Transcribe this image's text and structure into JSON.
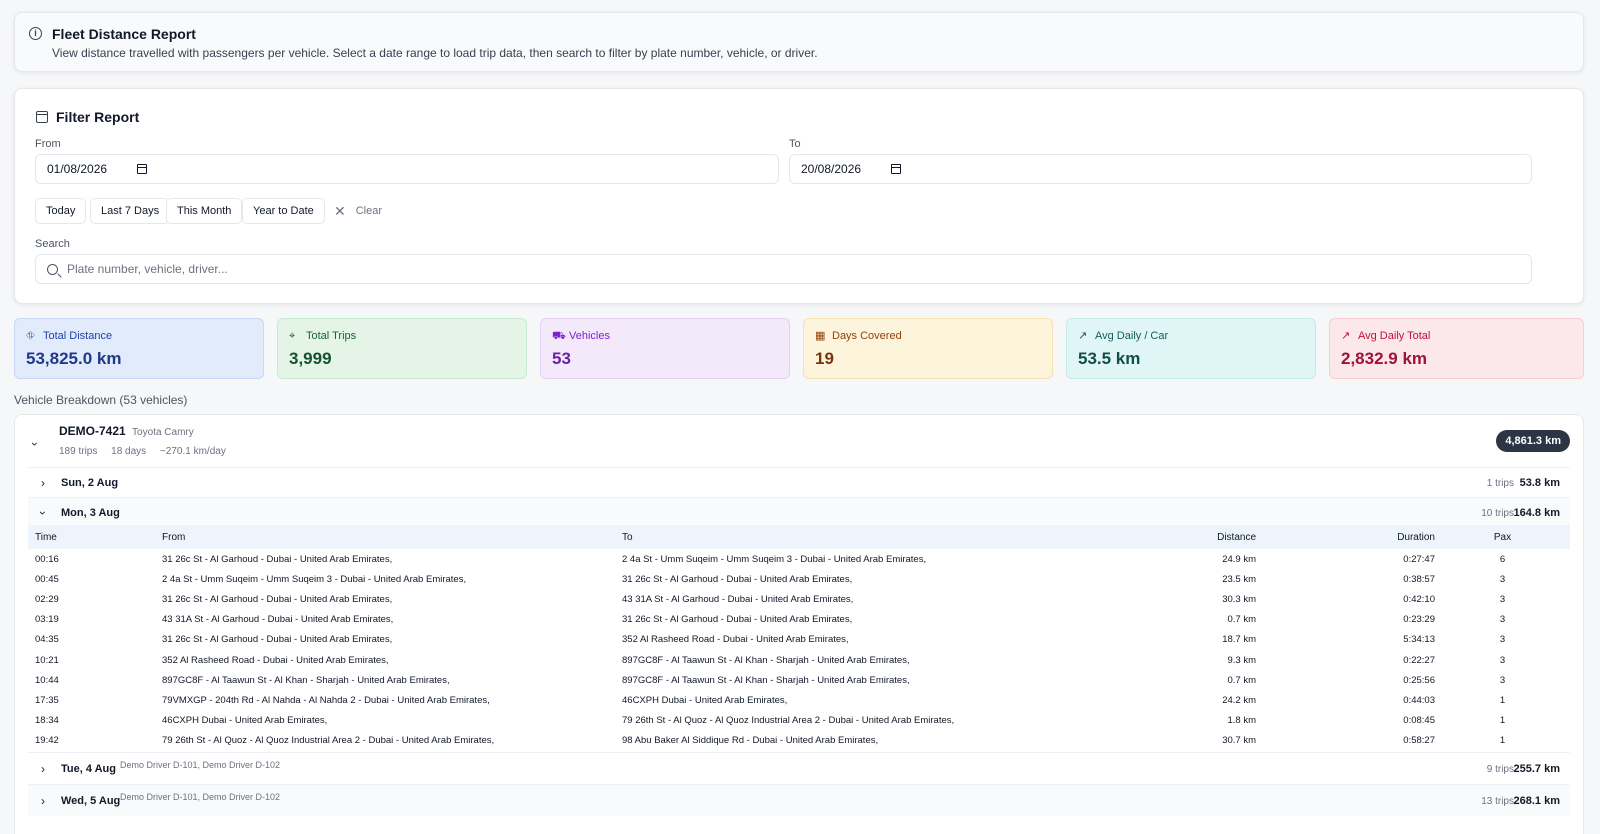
{
  "header": {
    "title": "Fleet Distance Report",
    "description": "View distance travelled with passengers per vehicle. Select a date range to load trip data, then search to filter by plate number, vehicle, or driver."
  },
  "filter": {
    "title": "Filter Report",
    "from_label": "From",
    "from_value": "01/08/2026",
    "to_label": "To",
    "to_value": "20/08/2026",
    "quick": [
      "Today",
      "Last 7 Days",
      "This Month",
      "Year to Date"
    ],
    "clear_label": "Clear",
    "search_label": "Search",
    "search_placeholder": "Plate number, vehicle, driver..."
  },
  "stats": [
    {
      "label": "Total Distance",
      "value": "53,825.0 km",
      "icon": "route-icon",
      "color": "#1e40af"
    },
    {
      "label": "Total Trips",
      "value": "3,999",
      "icon": "map-pin-icon",
      "color": "#166534"
    },
    {
      "label": "Vehicles",
      "value": "53",
      "icon": "car-icon",
      "color": "#7e22ce"
    },
    {
      "label": "Days Covered",
      "value": "19",
      "icon": "calendar-icon",
      "color": "#92400e"
    },
    {
      "label": "Avg Daily / Car",
      "value": "53.5 km",
      "icon": "trend-up-icon",
      "color": "#115e59"
    },
    {
      "label": "Avg Daily Total",
      "value": "2,832.9 km",
      "icon": "trend-up-icon",
      "color": "#be123c"
    }
  ],
  "breakdown_title": "Vehicle Breakdown (53 vehicles)",
  "vehicle": {
    "plate": "DEMO-7421",
    "model": "Toyota Camry",
    "trips": "189 trips",
    "days": "18 days",
    "per_day": "~270.1 km/day",
    "total": "4,861.3 km"
  },
  "days": [
    {
      "label": "Sun, 2 Aug",
      "drivers": "",
      "trips": "1 trips",
      "km": "53.8 km"
    },
    {
      "label": "Mon, 3 Aug",
      "drivers": "",
      "trips": "10 trips",
      "km": "164.8 km"
    },
    {
      "label": "Tue, 4 Aug",
      "drivers": "Demo Driver D-101, Demo Driver D-102",
      "trips": "9 trips",
      "km": "255.7 km"
    },
    {
      "label": "Wed, 5 Aug",
      "drivers": "Demo Driver D-101, Demo Driver D-102",
      "trips": "13 trips",
      "km": "268.1 km"
    }
  ],
  "table": {
    "headers": [
      "Time",
      "From",
      "To",
      "Distance",
      "Duration",
      "Pax"
    ],
    "rows": [
      [
        "00:16",
        "31 26c St - Al Garhoud - Dubai - United Arab Emirates,",
        "2 4a St - Umm Suqeim - Umm Suqeim 3 - Dubai - United Arab Emirates,",
        "24.9 km",
        "0:27:47",
        "6"
      ],
      [
        "00:45",
        "2 4a St - Umm Suqeim - Umm Suqeim 3 - Dubai - United Arab Emirates,",
        "31 26c St - Al Garhoud - Dubai - United Arab Emirates,",
        "23.5 km",
        "0:38:57",
        "3"
      ],
      [
        "02:29",
        "31 26c St - Al Garhoud - Dubai - United Arab Emirates,",
        "43 31A St - Al Garhoud - Dubai - United Arab Emirates,",
        "30.3 km",
        "0:42:10",
        "3"
      ],
      [
        "03:19",
        "43 31A St - Al Garhoud - Dubai - United Arab Emirates,",
        "31 26c St - Al Garhoud - Dubai - United Arab Emirates,",
        "0.7 km",
        "0:23:29",
        "3"
      ],
      [
        "04:35",
        "31 26c St - Al Garhoud - Dubai - United Arab Emirates,",
        "352 Al Rasheed Road - Dubai - United Arab Emirates,",
        "18.7 km",
        "5:34:13",
        "3"
      ],
      [
        "10:21",
        "352 Al Rasheed Road - Dubai - United Arab Emirates,",
        "897GC8F - Al Taawun St - Al Khan - Sharjah - United Arab Emirates,",
        "9.3 km",
        "0:22:27",
        "3"
      ],
      [
        "10:44",
        "897GC8F - Al Taawun St - Al Khan - Sharjah - United Arab Emirates,",
        "897GC8F - Al Taawun St - Al Khan - Sharjah - United Arab Emirates,",
        "0.7 km",
        "0:25:56",
        "3"
      ],
      [
        "17:35",
        "79VMXGP - 204th Rd - Al Nahda - Al Nahda 2 - Dubai - United Arab Emirates,",
        "46CXPH Dubai - United Arab Emirates,",
        "24.2 km",
        "0:44:03",
        "1"
      ],
      [
        "18:34",
        "46CXPH Dubai - United Arab Emirates,",
        "79 26th St - Al Quoz - Al Quoz Industrial Area 2 - Dubai - United Arab Emirates,",
        "1.8 km",
        "0:08:45",
        "1"
      ],
      [
        "19:42",
        "79 26th St - Al Quoz - Al Quoz Industrial Area 2 - Dubai - United Arab Emirates,",
        "98 Abu Baker Al Siddique Rd - Dubai - United Arab Emirates,",
        "30.7 km",
        "0:58:27",
        "1"
      ]
    ]
  }
}
